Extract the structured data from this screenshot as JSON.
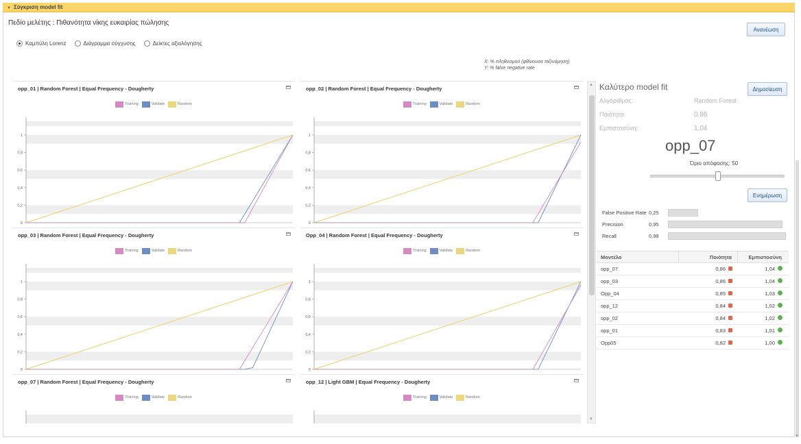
{
  "window": {
    "title": "Σύγκριση model fit"
  },
  "study_label": "Πεδίο μελέτης : Πιθανότητα νίκης ευκαιρίας πώλησης",
  "buttons": {
    "refresh": "Ανανέωση",
    "publish": "Δημοσίευση",
    "update": "Ενημέρωση"
  },
  "view_options": [
    {
      "label": "Καμπύλη Lorenz",
      "selected": true
    },
    {
      "label": "Διάγραμμα σύγχυσης",
      "selected": false
    },
    {
      "label": "Δείκτες αξιολόγησης",
      "selected": false
    }
  ],
  "axis_legend": {
    "x": "X: % πληθυσμού (φθίνουσα ταξινόμηση)",
    "y": "Y: % false negative rate"
  },
  "legend": [
    {
      "name": "Training",
      "color": "#d58ac3"
    },
    {
      "name": "Validate",
      "color": "#6e8ec3"
    },
    {
      "name": "Random",
      "color": "#ecd77e"
    }
  ],
  "y_ticks": [
    "0",
    "0,2",
    "0,4",
    "0,6",
    "0,8",
    "1"
  ],
  "chart_data": [
    {
      "type": "line",
      "title": "opp_01 | Random Forest | Equal Frequency - Dougherty",
      "xlim": [
        0,
        1
      ],
      "ylim": [
        0,
        1
      ],
      "series": [
        {
          "name": "Training",
          "x": [
            0,
            0.82,
            1
          ],
          "y": [
            0,
            0,
            1
          ]
        },
        {
          "name": "Validate",
          "x": [
            0,
            0.8,
            1
          ],
          "y": [
            0,
            0,
            1
          ]
        },
        {
          "name": "Random",
          "x": [
            0,
            1
          ],
          "y": [
            0,
            1
          ]
        }
      ]
    },
    {
      "type": "line",
      "title": "opp_02 | Random Forest | Equal Frequency - Dougherty",
      "xlim": [
        0,
        1
      ],
      "ylim": [
        0,
        1
      ],
      "series": [
        {
          "name": "Training",
          "x": [
            0,
            0.82,
            1
          ],
          "y": [
            0,
            0,
            0.92
          ]
        },
        {
          "name": "Validate",
          "x": [
            0,
            0.84,
            1
          ],
          "y": [
            0,
            0,
            1
          ]
        },
        {
          "name": "Random",
          "x": [
            0,
            1
          ],
          "y": [
            0,
            1
          ]
        }
      ]
    },
    {
      "type": "line",
      "title": "opp_03 | Random Forest | Equal Frequency - Dougherty",
      "xlim": [
        0,
        1
      ],
      "ylim": [
        0,
        1
      ],
      "series": [
        {
          "name": "Training",
          "x": [
            0,
            0.8,
            1
          ],
          "y": [
            0,
            0,
            1
          ]
        },
        {
          "name": "Validate",
          "x": [
            0,
            0.82,
            0.85,
            1
          ],
          "y": [
            0,
            0,
            0.02,
            1
          ]
        },
        {
          "name": "Random",
          "x": [
            0,
            1
          ],
          "y": [
            0,
            1
          ]
        }
      ]
    },
    {
      "type": "line",
      "title": "Opp_04 | Random Forest | Equal Frequency - Dougherty",
      "xlim": [
        0,
        1
      ],
      "ylim": [
        0,
        1
      ],
      "series": [
        {
          "name": "Training",
          "x": [
            0,
            0.82,
            1
          ],
          "y": [
            0,
            0,
            0.96
          ]
        },
        {
          "name": "Validate",
          "x": [
            0,
            0.84,
            1
          ],
          "y": [
            0,
            0,
            1
          ]
        },
        {
          "name": "Random",
          "x": [
            0,
            1
          ],
          "y": [
            0,
            1
          ]
        }
      ]
    },
    {
      "type": "line",
      "title": "opp_07 | Random Forest | Equal Frequency - Dougherty",
      "xlim": [
        0,
        1
      ],
      "ylim": [
        0,
        1
      ],
      "series": []
    },
    {
      "type": "line",
      "title": "opp_12 | Light GBM | Equal Frequency - Dougherty",
      "xlim": [
        0,
        1
      ],
      "ylim": [
        0,
        1
      ],
      "series": []
    }
  ],
  "best_fit": {
    "title": "Καλύτερο model fit",
    "algorithm_label": "Αλγόριθμος:",
    "algorithm_value": "Random Forest",
    "quality_label": "Ποιότητα:",
    "quality_value": "0,86",
    "reliability_label": "Εμπιστοσύνη:",
    "reliability_value": "1,04",
    "model": "opp_07",
    "threshold_label": "Όριο απόφασης: 50",
    "threshold": 50,
    "metrics": [
      {
        "label": "False Positive Rate",
        "value": "0,25",
        "level": 0.25
      },
      {
        "label": "Precision",
        "value": "0,95",
        "level": 0.95
      },
      {
        "label": "Recall",
        "value": "0,98",
        "level": 0.98
      }
    ]
  },
  "table": {
    "headers": [
      "Μοντέλο",
      "Ποιότητα",
      "Εμπιστοσύνη"
    ],
    "rows": [
      {
        "model": "opp_07",
        "quality": "0,86",
        "reliability": "1,04"
      },
      {
        "model": "opp_03",
        "quality": "0,86",
        "reliability": "1,04"
      },
      {
        "model": "Opp_04",
        "quality": "0,85",
        "reliability": "1,03"
      },
      {
        "model": "opp_12",
        "quality": "0,84",
        "reliability": "1,02"
      },
      {
        "model": "opp_02",
        "quality": "0,84",
        "reliability": "1,02"
      },
      {
        "model": "opp_01",
        "quality": "0,83",
        "reliability": "1,01"
      },
      {
        "model": "Opp05",
        "quality": "0,82",
        "reliability": "1,00"
      }
    ]
  }
}
